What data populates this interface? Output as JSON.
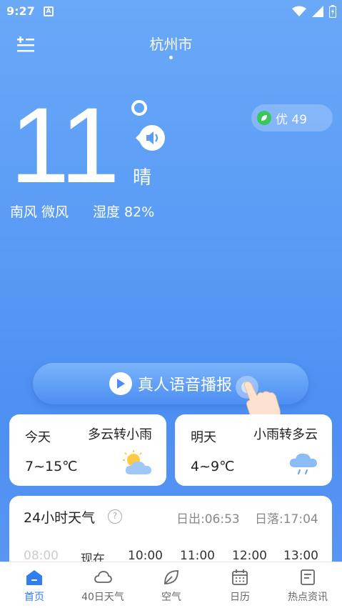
{
  "status": {
    "time": "9:27",
    "a_badge": "A"
  },
  "header": {
    "city": "杭州市"
  },
  "current": {
    "temperature": "11",
    "condition": "晴",
    "wind": "南风 微风",
    "humidity": "湿度 82%",
    "aqi": "优 49"
  },
  "voice": {
    "label": "真人语音播报"
  },
  "forecast": {
    "today": {
      "day": "今天",
      "desc": "多云转小雨",
      "range": "7~15℃",
      "icon": "partly-cloudy-icon"
    },
    "tomorrow": {
      "day": "明天",
      "desc": "小雨转多云",
      "range": "4~9℃",
      "icon": "rain-cloud-icon"
    }
  },
  "hourly": {
    "title": "24小时天气",
    "sunrise": "日出:06:53",
    "sunset": "日落:17:04",
    "hours": [
      "08:00",
      "现在",
      "10:00",
      "11:00",
      "12:00",
      "13:00"
    ]
  },
  "nav": {
    "items": [
      {
        "label": "首页",
        "icon": "home-icon",
        "active": true
      },
      {
        "label": "40日天气",
        "icon": "cloud-icon",
        "active": false
      },
      {
        "label": "空气",
        "icon": "leaf-icon",
        "active": false
      },
      {
        "label": "日历",
        "icon": "calendar-icon",
        "active": false
      },
      {
        "label": "热点资讯",
        "icon": "news-icon",
        "active": false
      }
    ]
  },
  "colors": {
    "accent": "#2f7ff0",
    "aqi_green": "#39c65b"
  }
}
